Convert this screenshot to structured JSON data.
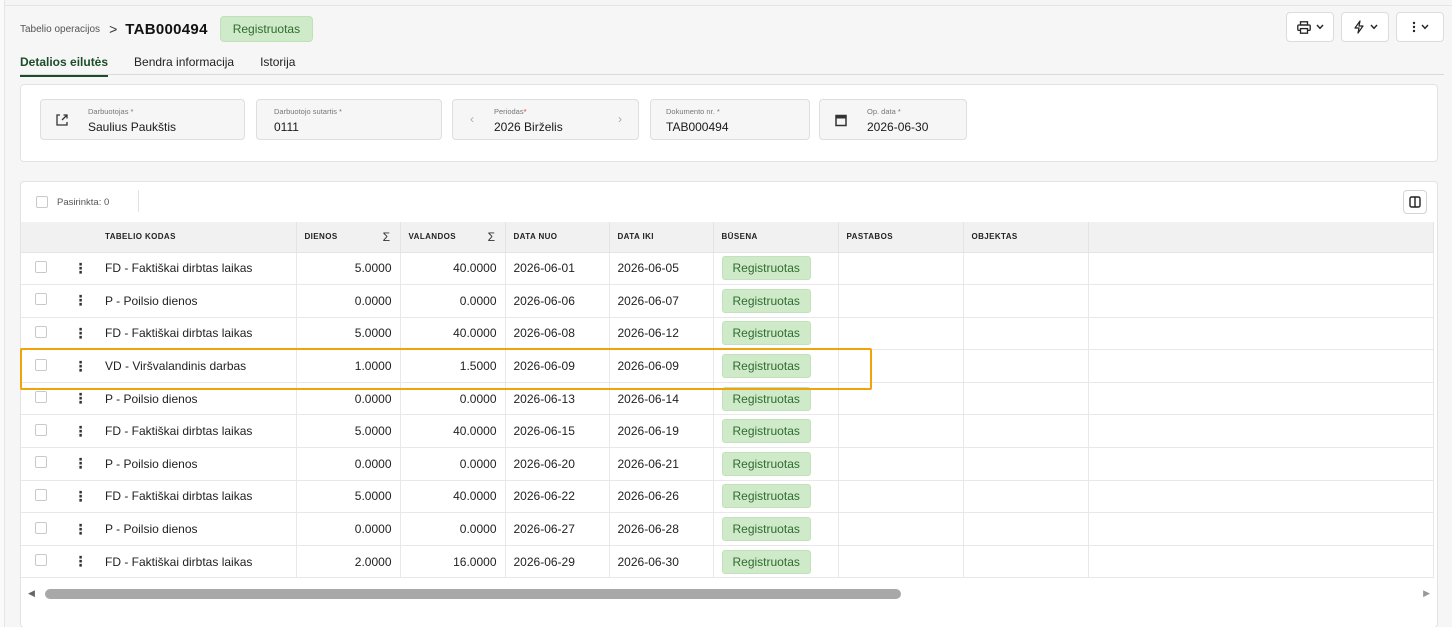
{
  "breadcrumb": {
    "parent": "Tabelio operacijos",
    "separator": ">",
    "current": "TAB000494"
  },
  "header_status": "Registruotas",
  "top_actions": [
    {
      "icon": "printer-icon"
    },
    {
      "icon": "lightning-icon"
    },
    {
      "icon": "kebab-icon"
    }
  ],
  "tabs": [
    {
      "label": "Detalios eilutės",
      "active": true
    },
    {
      "label": "Bendra informacija",
      "active": false
    },
    {
      "label": "Istorija",
      "active": false
    }
  ],
  "fields": {
    "employee": {
      "label": "Darbuotojas",
      "req": "*",
      "value": "Saulius Paukštis"
    },
    "contract": {
      "label": "Darbuotojo sutartis",
      "req": "*",
      "value": "0111"
    },
    "period": {
      "label": "Periodas",
      "req": "*",
      "value": "2026 Birželis",
      "prev": "‹",
      "next": "›"
    },
    "doc_no": {
      "label": "Dokumento nr.",
      "req": "*",
      "value": "TAB000494"
    },
    "op_date": {
      "label": "Op. data",
      "req": "*",
      "value": "2026-06-30"
    }
  },
  "table": {
    "selected_label": "Pasirinkta: 0",
    "headers": {
      "code": "TABELIO KODAS",
      "days": "DIENOS",
      "hours": "VALANDOS",
      "date_from": "DATA NUO",
      "date_to": "DATA IKI",
      "status": "BŪSENA",
      "notes": "PASTABOS",
      "object": "OBJEKTAS",
      "sigma": "Σ"
    },
    "rows": [
      {
        "code": "FD - Faktiškai dirbtas laikas",
        "days": "5.0000",
        "hours": "40.0000",
        "from": "2026-06-01",
        "to": "2026-06-05",
        "status": "Registruotas",
        "notes": "",
        "object": ""
      },
      {
        "code": "P - Poilsio dienos",
        "days": "0.0000",
        "hours": "0.0000",
        "from": "2026-06-06",
        "to": "2026-06-07",
        "status": "Registruotas",
        "notes": "",
        "object": ""
      },
      {
        "code": "FD - Faktiškai dirbtas laikas",
        "days": "5.0000",
        "hours": "40.0000",
        "from": "2026-06-08",
        "to": "2026-06-12",
        "status": "Registruotas",
        "notes": "",
        "object": ""
      },
      {
        "code": "VD - Viršvalandinis darbas",
        "days": "1.0000",
        "hours": "1.5000",
        "from": "2026-06-09",
        "to": "2026-06-09",
        "status": "Registruotas",
        "notes": "",
        "object": ""
      },
      {
        "code": "P - Poilsio dienos",
        "days": "0.0000",
        "hours": "0.0000",
        "from": "2026-06-13",
        "to": "2026-06-14",
        "status": "Registruotas",
        "notes": "",
        "object": ""
      },
      {
        "code": "FD - Faktiškai dirbtas laikas",
        "days": "5.0000",
        "hours": "40.0000",
        "from": "2026-06-15",
        "to": "2026-06-19",
        "status": "Registruotas",
        "notes": "",
        "object": ""
      },
      {
        "code": "P - Poilsio dienos",
        "days": "0.0000",
        "hours": "0.0000",
        "from": "2026-06-20",
        "to": "2026-06-21",
        "status": "Registruotas",
        "notes": "",
        "object": ""
      },
      {
        "code": "FD - Faktiškai dirbtas laikas",
        "days": "5.0000",
        "hours": "40.0000",
        "from": "2026-06-22",
        "to": "2026-06-26",
        "status": "Registruotas",
        "notes": "",
        "object": ""
      },
      {
        "code": "P - Poilsio dienos",
        "days": "0.0000",
        "hours": "0.0000",
        "from": "2026-06-27",
        "to": "2026-06-28",
        "status": "Registruotas",
        "notes": "",
        "object": ""
      },
      {
        "code": "FD - Faktiškai dirbtas laikas",
        "days": "2.0000",
        "hours": "16.0000",
        "from": "2026-06-29",
        "to": "2026-06-30",
        "status": "Registruotas",
        "notes": "",
        "object": ""
      }
    ],
    "highlighted_row_index": 3
  },
  "colors": {
    "accent": "#1b4d2a",
    "pill_bg": "#cfeac9",
    "pill_text": "#2f6b2f",
    "highlight": "#f0a30a"
  }
}
